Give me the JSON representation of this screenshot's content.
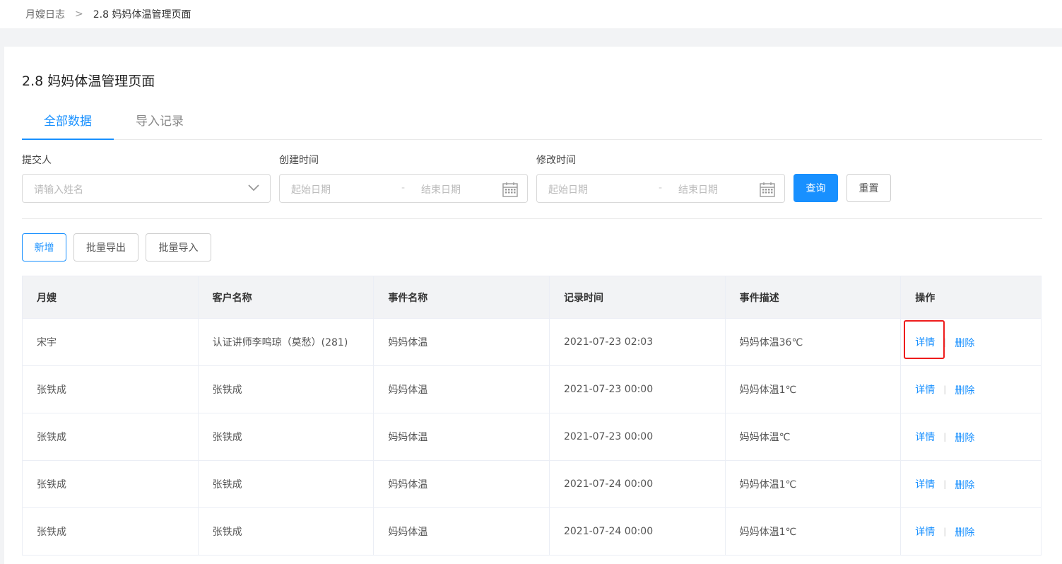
{
  "breadcrumb": {
    "parent": "月嫂日志",
    "separator": ">",
    "current": "2.8 妈妈体温管理页面"
  },
  "page_title": "2.8 妈妈体温管理页面",
  "tabs": [
    {
      "label": "全部数据",
      "active": true
    },
    {
      "label": "导入记录",
      "active": false
    }
  ],
  "filters": {
    "submitter": {
      "label": "提交人",
      "placeholder": "请输入姓名"
    },
    "created": {
      "label": "创建时间",
      "start_placeholder": "起始日期",
      "dash": "-",
      "end_placeholder": "结束日期"
    },
    "modified": {
      "label": "修改时间",
      "start_placeholder": "起始日期",
      "dash": "-",
      "end_placeholder": "结束日期"
    },
    "query_label": "查询",
    "reset_label": "重置"
  },
  "toolbar": {
    "add_label": "新增",
    "export_label": "批量导出",
    "import_label": "批量导入"
  },
  "table": {
    "columns": [
      "月嫂",
      "客户名称",
      "事件名称",
      "记录时间",
      "事件描述",
      "操作"
    ],
    "rows": [
      {
        "nanny": "宋宇",
        "customer": "认证讲师李鸣琼（莫愁）(281)",
        "event": "妈妈体温",
        "time": "2021-07-23 02:03",
        "desc": "妈妈体温36℃"
      },
      {
        "nanny": "张铁成",
        "customer": "张铁成",
        "event": "妈妈体温",
        "time": "2021-07-23 00:00",
        "desc": "妈妈体温1℃"
      },
      {
        "nanny": "张铁成",
        "customer": "张铁成",
        "event": "妈妈体温",
        "time": "2021-07-23 00:00",
        "desc": "妈妈体温℃"
      },
      {
        "nanny": "张铁成",
        "customer": "张铁成",
        "event": "妈妈体温",
        "time": "2021-07-24 00:00",
        "desc": "妈妈体温1℃"
      },
      {
        "nanny": "张铁成",
        "customer": "张铁成",
        "event": "妈妈体温",
        "time": "2021-07-24 00:00",
        "desc": "妈妈体温1℃"
      }
    ],
    "detail_label": "详情",
    "op_separator": "|",
    "delete_label": "删除"
  },
  "colors": {
    "accent": "#1890ff",
    "highlight": "#ee1c1c"
  }
}
